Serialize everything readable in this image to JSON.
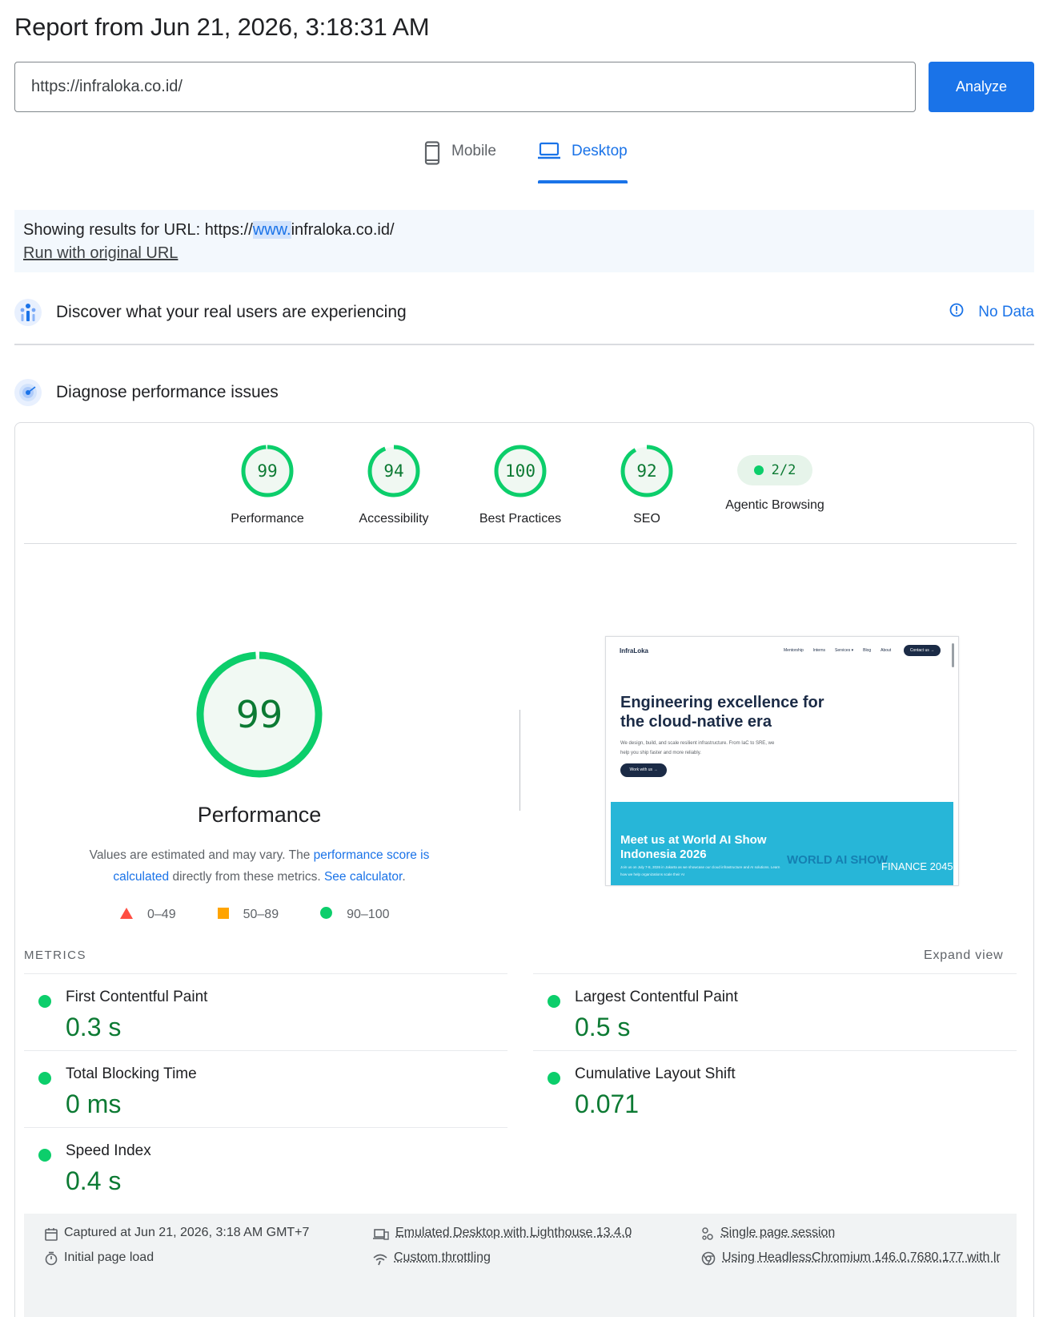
{
  "header": {
    "title": "Report from Jun 21, 2026, 3:18:31 AM"
  },
  "search": {
    "url_value": "https://infraloka.co.id/",
    "analyze_label": "Analyze"
  },
  "device_tabs": {
    "mobile_label": "Mobile",
    "desktop_label": "Desktop",
    "active": "Desktop"
  },
  "url_notice": {
    "prefix": "Showing results for URL: https://",
    "highlight": "www.",
    "suffix": "infraloka.co.id/",
    "rerun_label": "Run with original URL"
  },
  "crux": {
    "title": "Discover what your real users are experiencing",
    "status": "No Data"
  },
  "diagnose": {
    "title": "Diagnose performance issues"
  },
  "categories": [
    {
      "label": "Performance",
      "score": "99",
      "fraction": 0.99
    },
    {
      "label": "Accessibility",
      "score": "94",
      "fraction": 0.94
    },
    {
      "label": "Best Practices",
      "score": "100",
      "fraction": 1.0
    },
    {
      "label": "SEO",
      "score": "92",
      "fraction": 0.92
    },
    {
      "label": "Agentic Browsing",
      "score": "2/2"
    }
  ],
  "performance": {
    "score": "99",
    "fraction": 0.99,
    "title": "Performance",
    "desc_prefix": "Values are estimated and may vary. The ",
    "desc_link1": "performance score is calculated",
    "desc_mid": " directly from these metrics. ",
    "desc_link2": "See calculator",
    "desc_suffix": "."
  },
  "legend": {
    "fail": "0–49",
    "average": "50–89",
    "pass": "90–100"
  },
  "screenshot": {
    "logo": "InfraLoka",
    "nav": [
      "Mentorship",
      "Interns",
      "Services ▾",
      "Blog",
      "About"
    ],
    "contact": "Contact us →",
    "heading": "Engineering excellence for the cloud-native era",
    "subtext": "We design, build, and scale resilient infrastructure. From IaC to SRE, we help you ship faster and more reliably.",
    "cta": "Work with us →",
    "banner_title": "Meet us at World AI Show Indonesia 2026",
    "banner_sub": "Join us on July 7-8, 2026 in Jakarta as we showcase our cloud infrastructure and AI solutions. Learn how we help organizations scale their AI",
    "banner_logo": "WORLD AI SHOW",
    "banner_logo2": "FINANCE 2045"
  },
  "metrics": {
    "header": "METRICS",
    "expand": "Expand view",
    "fcp": {
      "name": "First Contentful Paint",
      "value": "0.3 s"
    },
    "lcp": {
      "name": "Largest Contentful Paint",
      "value": "0.5 s"
    },
    "tbt": {
      "name": "Total Blocking Time",
      "value": "0 ms"
    },
    "cls": {
      "name": "Cumulative Layout Shift",
      "value": "0.071"
    },
    "si": {
      "name": "Speed Index",
      "value": "0.4 s"
    }
  },
  "runtime": {
    "captured": "Captured at Jun 21, 2026, 3:18 AM GMT+7",
    "initial": "Initial page load",
    "emulated": "Emulated Desktop with Lighthouse 13.4.0",
    "throttling": "Custom throttling",
    "session": "Single page session",
    "browser": "Using HeadlessChromium 146.0.7680.177 with lr"
  },
  "colors": {
    "accent": "#1a73e8",
    "pass": "#0cce6b",
    "pass_text": "#0c7a33",
    "average": "#ffa400",
    "fail": "#ff4e42"
  }
}
